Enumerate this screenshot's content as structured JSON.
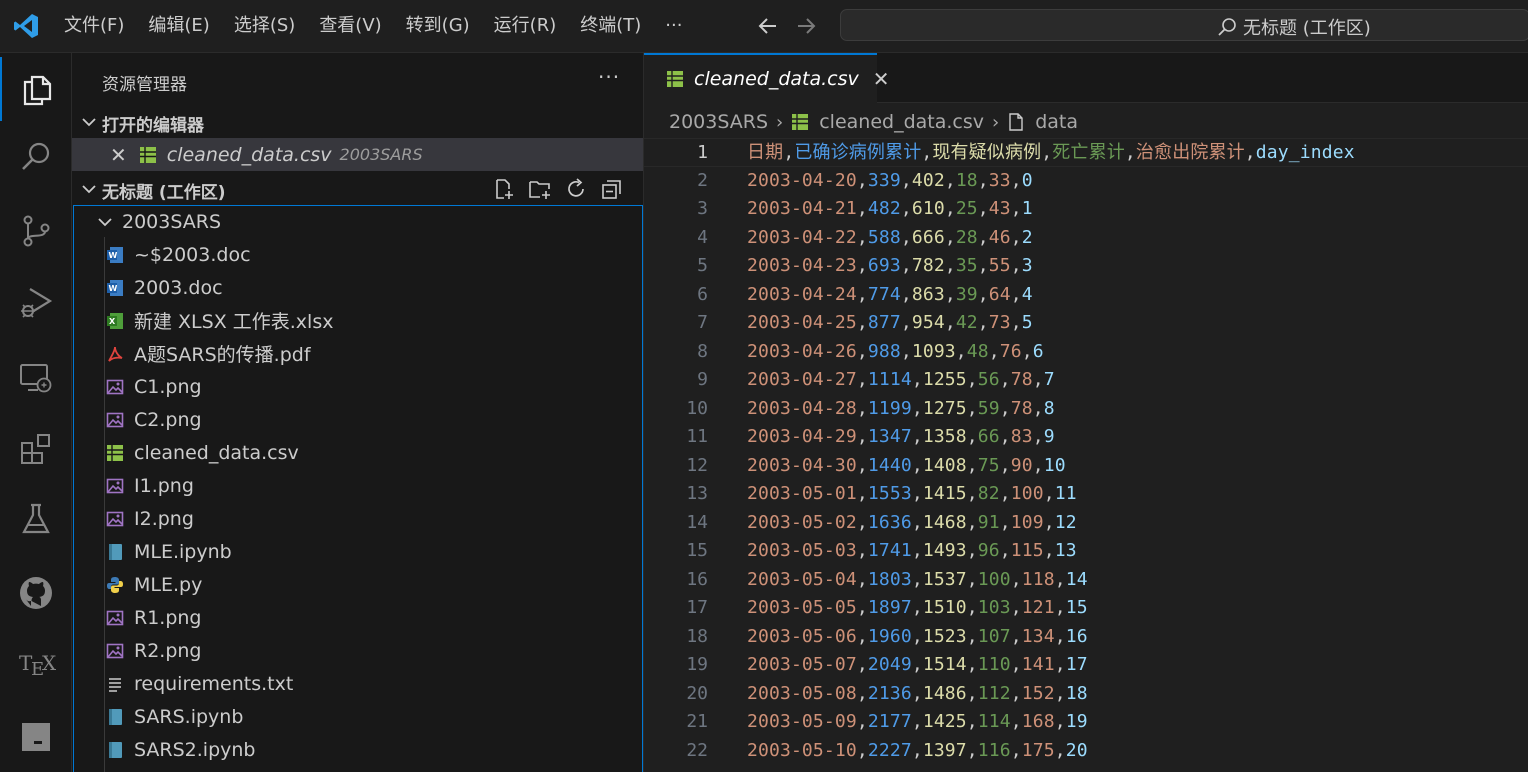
{
  "titlebar": {
    "menu": [
      "文件(F)",
      "编辑(E)",
      "选择(S)",
      "查看(V)",
      "转到(G)",
      "运行(R)",
      "终端(T)",
      "···"
    ],
    "search_text": "无标题 (工作区)"
  },
  "sidebar": {
    "title": "资源管理器",
    "more": "···",
    "open_editors_label": "打开的编辑器",
    "open_editor": {
      "name": "cleaned_data.csv",
      "folder": "2003SARS"
    },
    "workspace_label": "无标题 (工作区)",
    "folder": "2003SARS",
    "files": [
      {
        "name": "~$2003.doc",
        "icon": "word-icon"
      },
      {
        "name": "2003.doc",
        "icon": "word-icon"
      },
      {
        "name": "新建 XLSX 工作表.xlsx",
        "icon": "excel-icon"
      },
      {
        "name": "A题SARS的传播.pdf",
        "icon": "pdf-icon"
      },
      {
        "name": "C1.png",
        "icon": "image-icon"
      },
      {
        "name": "C2.png",
        "icon": "image-icon"
      },
      {
        "name": "cleaned_data.csv",
        "icon": "csv-icon"
      },
      {
        "name": "I1.png",
        "icon": "image-icon"
      },
      {
        "name": "I2.png",
        "icon": "image-icon"
      },
      {
        "name": "MLE.ipynb",
        "icon": "notebook-icon"
      },
      {
        "name": "MLE.py",
        "icon": "python-icon"
      },
      {
        "name": "R1.png",
        "icon": "image-icon"
      },
      {
        "name": "R2.png",
        "icon": "image-icon"
      },
      {
        "name": "requirements.txt",
        "icon": "text-file-icon"
      },
      {
        "name": "SARS.ipynb",
        "icon": "notebook-icon"
      },
      {
        "name": "SARS2.ipynb",
        "icon": "notebook-icon"
      }
    ]
  },
  "editor": {
    "tab_label": "cleaned_data.csv",
    "tab_close": "✕",
    "breadcrumb": [
      "2003SARS",
      "cleaned_data.csv",
      "data"
    ],
    "current_line": 1,
    "lines": [
      [
        "日期",
        "已确诊病例累计",
        "现有疑似病例",
        "死亡累计",
        "治愈出院累计",
        "day_index"
      ],
      [
        "2003-04-20",
        "339",
        "402",
        "18",
        "33",
        "0"
      ],
      [
        "2003-04-21",
        "482",
        "610",
        "25",
        "43",
        "1"
      ],
      [
        "2003-04-22",
        "588",
        "666",
        "28",
        "46",
        "2"
      ],
      [
        "2003-04-23",
        "693",
        "782",
        "35",
        "55",
        "3"
      ],
      [
        "2003-04-24",
        "774",
        "863",
        "39",
        "64",
        "4"
      ],
      [
        "2003-04-25",
        "877",
        "954",
        "42",
        "73",
        "5"
      ],
      [
        "2003-04-26",
        "988",
        "1093",
        "48",
        "76",
        "6"
      ],
      [
        "2003-04-27",
        "1114",
        "1255",
        "56",
        "78",
        "7"
      ],
      [
        "2003-04-28",
        "1199",
        "1275",
        "59",
        "78",
        "8"
      ],
      [
        "2003-04-29",
        "1347",
        "1358",
        "66",
        "83",
        "9"
      ],
      [
        "2003-04-30",
        "1440",
        "1408",
        "75",
        "90",
        "10"
      ],
      [
        "2003-05-01",
        "1553",
        "1415",
        "82",
        "100",
        "11"
      ],
      [
        "2003-05-02",
        "1636",
        "1468",
        "91",
        "109",
        "12"
      ],
      [
        "2003-05-03",
        "1741",
        "1493",
        "96",
        "115",
        "13"
      ],
      [
        "2003-05-04",
        "1803",
        "1537",
        "100",
        "118",
        "14"
      ],
      [
        "2003-05-05",
        "1897",
        "1510",
        "103",
        "121",
        "15"
      ],
      [
        "2003-05-06",
        "1960",
        "1523",
        "107",
        "134",
        "16"
      ],
      [
        "2003-05-07",
        "2049",
        "1514",
        "110",
        "141",
        "17"
      ],
      [
        "2003-05-08",
        "2136",
        "1486",
        "112",
        "152",
        "18"
      ],
      [
        "2003-05-09",
        "2177",
        "1425",
        "114",
        "168",
        "19"
      ],
      [
        "2003-05-10",
        "2227",
        "1397",
        "116",
        "175",
        "20"
      ]
    ]
  },
  "colors": {
    "accent": "#0078d4",
    "column_colors": [
      "#ce9178",
      "#4f9be8",
      "#dcdcaa",
      "#6a9955",
      "#ce9178",
      "#9cdcfe"
    ]
  }
}
